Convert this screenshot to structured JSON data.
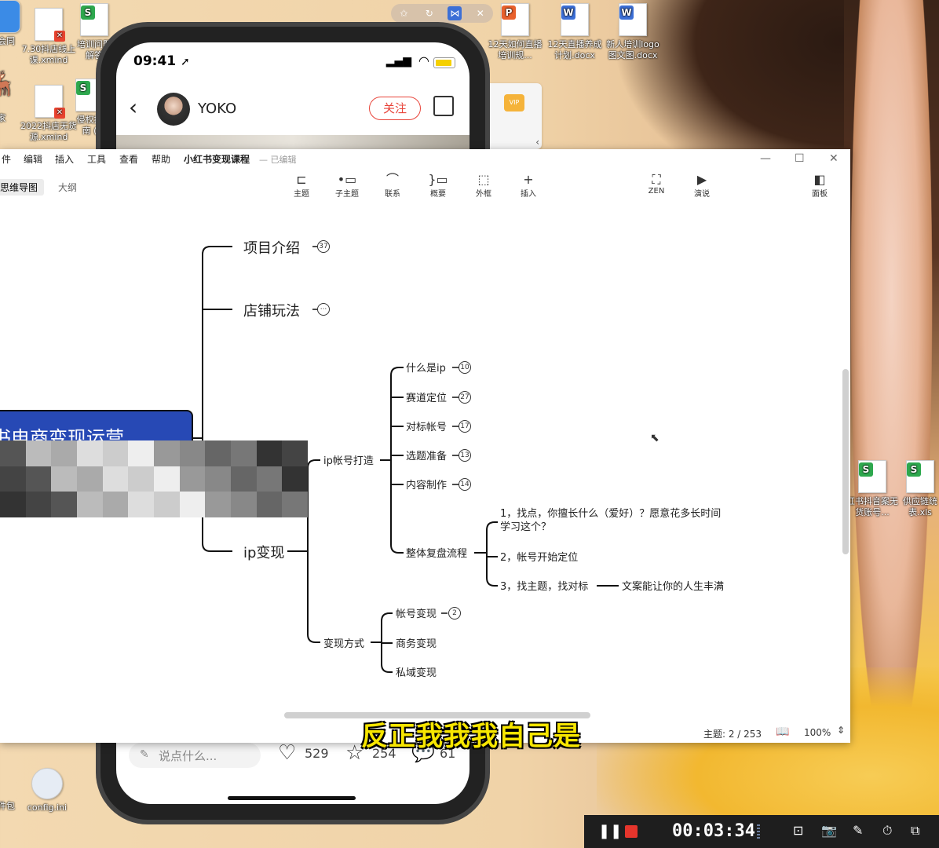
{
  "desktop": {
    "icons": [
      {
        "label": "会同",
        "kind": "generic"
      },
      {
        "label": "7.30抖店线上课.xmind",
        "kind": "xmind"
      },
      {
        "label": "培训问题解答",
        "kind": "sheet"
      },
      {
        "label": "x",
        "kind": "generic"
      },
      {
        "label": "12天如何直播培训规...",
        "kind": "ppt"
      },
      {
        "label": "12天直播养成计划.docx",
        "kind": "word"
      },
      {
        "label": "新人培训logo图文图.docx",
        "kind": "word"
      },
      {
        "label": "家",
        "kind": "generic"
      },
      {
        "label": "2022抖店无货源.xmind",
        "kind": "xmind"
      },
      {
        "label": "侵权指南 (",
        "kind": "sheet"
      },
      {
        "label": "红书抖音案无货账号...",
        "kind": "sheet"
      },
      {
        "label": "供应链统表.xls",
        "kind": "sheet"
      },
      {
        "label": "config.ini",
        "kind": "config"
      },
      {
        "label": "件包",
        "kind": "generic"
      }
    ]
  },
  "floatbar": {
    "items": [
      "pin-icon",
      "refresh-icon",
      "xmind-icon",
      "close-icon"
    ]
  },
  "phone": {
    "time": "09:41",
    "username": "YOKO",
    "follow_label": "关注",
    "comment_placeholder": "说点什么...",
    "likes": "529",
    "stars": "254",
    "comments": "61"
  },
  "app": {
    "menu": [
      "件",
      "编辑",
      "插入",
      "工具",
      "查看",
      "帮助"
    ],
    "doc_title": "小红书变现课程",
    "doc_status": "— 已编辑",
    "view_tabs": [
      "思维导图",
      "大纲"
    ],
    "toolbar": [
      {
        "label": "主题",
        "icon": "topic-icon"
      },
      {
        "label": "子主题",
        "icon": "subtopic-icon"
      },
      {
        "label": "联系",
        "icon": "relationship-icon"
      },
      {
        "label": "概要",
        "icon": "summary-icon"
      },
      {
        "label": "外框",
        "icon": "boundary-icon"
      },
      {
        "label": "插入",
        "icon": "insert-icon"
      },
      {
        "label": "ZEN",
        "icon": "zen-icon"
      },
      {
        "label": "演说",
        "icon": "present-icon"
      },
      {
        "label": "面板",
        "icon": "panel-icon"
      }
    ],
    "status": {
      "topic_count": "主题: 2 / 253",
      "zoom": "100%"
    }
  },
  "mindmap": {
    "root": "书电商变现运营",
    "branches": [
      {
        "label": "项目介绍",
        "count": "37"
      },
      {
        "label": "店铺玩法",
        "count": "···"
      },
      {
        "label": "ip变现",
        "count": ""
      }
    ],
    "ip_children": {
      "ip_account": {
        "label": "ip帐号打造",
        "items": [
          {
            "label": "什么是ip",
            "count": "10"
          },
          {
            "label": "赛道定位",
            "count": "27"
          },
          {
            "label": "对标帐号",
            "count": "17"
          },
          {
            "label": "选题准备",
            "count": "13"
          },
          {
            "label": "内容制作",
            "count": "14"
          }
        ],
        "review": {
          "label": "整体复盘流程",
          "steps": [
            "1，找点，你擅长什么（爱好）？愿意花多长时间学习这个？",
            "2，帐号开始定位",
            "3，找主题，找对标"
          ],
          "step3_child": "文案能让你的人生丰满"
        }
      },
      "monetize": {
        "label": "变现方式",
        "items": [
          {
            "label": "帐号变现",
            "count": "2"
          },
          {
            "label": "商务变现",
            "count": ""
          },
          {
            "label": "私域变现",
            "count": ""
          }
        ]
      }
    }
  },
  "subtitle": "反正我我我自己是",
  "recorder": {
    "timer": "00:03:34"
  }
}
